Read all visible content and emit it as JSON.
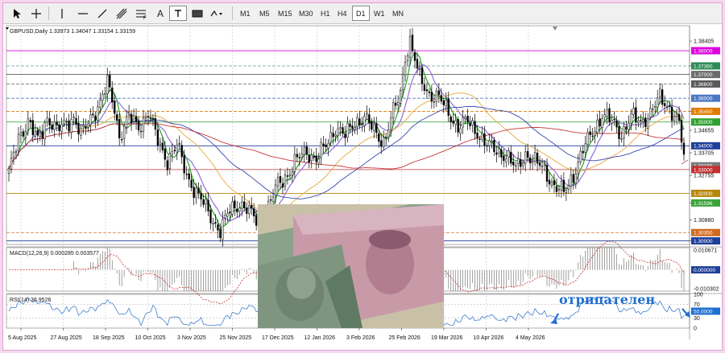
{
  "toolbar": {
    "timeframes": [
      {
        "label": "M1",
        "active": false
      },
      {
        "label": "M5",
        "active": false
      },
      {
        "label": "M15",
        "active": false
      },
      {
        "label": "M30",
        "active": false
      },
      {
        "label": "H1",
        "active": false
      },
      {
        "label": "H4",
        "active": false
      },
      {
        "label": "D1",
        "active": true
      },
      {
        "label": "W1",
        "active": false
      },
      {
        "label": "MN",
        "active": false
      }
    ],
    "text_tool_label": "A",
    "fibo_label": "F"
  },
  "main_pane": {
    "info": "GBPUSD,Daily  1.33973 1.34047 1.33154 1.33159"
  },
  "macd_pane": {
    "info": "MACD(12,26,9) 0.000285 0.003577"
  },
  "rsi_pane": {
    "info": "RSI(14) 36.9526",
    "annotation": "отрицателен",
    "current_value_label": "50.0000"
  },
  "chart_data": [
    {
      "type": "candlestick",
      "symbol": "GBPUSD",
      "timeframe": "Daily",
      "x_labels": [
        "5 Aug 2025",
        "27 Aug 2025",
        "18 Sep 2025",
        "10 Oct 2025",
        "3 Nov 2025",
        "25 Nov 2025",
        "17 Dec 2025",
        "12 Jan 2026",
        "3 Feb 2026",
        "25 Feb 2026",
        "19 Mar 2026",
        "10 Apr 2026",
        "4 May 2026"
      ],
      "y_ticks": [
        "1.38405",
        "1.37360",
        "1.35450",
        "1.34655",
        "1.33705",
        "1.32755",
        "1.31596",
        "1.30880",
        "1.30000"
      ],
      "price_tags": [
        {
          "label": "1.38000",
          "value": 1.38,
          "color": "#dd00dd"
        },
        {
          "label": "1.37360",
          "value": 1.3736,
          "color": "#2e8b57"
        },
        {
          "label": "1.37000",
          "value": 1.37,
          "color": "#6b6b6b"
        },
        {
          "label": "1.36600",
          "value": 1.366,
          "color": "#5a5a5a"
        },
        {
          "label": "1.36000",
          "value": 1.36,
          "color": "#4a78c2"
        },
        {
          "label": "1.35450",
          "value": 1.3545,
          "color": "#e07b00"
        },
        {
          "label": "1.35000",
          "value": 1.35,
          "color": "#2ea02e"
        },
        {
          "label": "1.34000",
          "value": 1.34,
          "color": "#1f3f9a"
        },
        {
          "label": "1.33159",
          "value": 1.33159,
          "color": "#7a7a7a"
        },
        {
          "label": "1.33000",
          "value": 1.33,
          "color": "#c53030"
        },
        {
          "label": "1.32000",
          "value": 1.32,
          "color": "#b8860b"
        },
        {
          "label": "1.31596",
          "value": 1.31596,
          "color": "#3aa33a"
        },
        {
          "label": "1.30350",
          "value": 1.3035,
          "color": "#d2691e"
        },
        {
          "label": "1.30000",
          "value": 1.3,
          "color": "#1f3f9a"
        }
      ],
      "levels": [
        {
          "value": 1.38,
          "color": "#dd00dd",
          "style": "solid"
        },
        {
          "value": 1.3736,
          "color": "#5aa0a0",
          "style": "dashed"
        },
        {
          "value": 1.37,
          "color": "#444444",
          "style": "solid"
        },
        {
          "value": 1.366,
          "color": "#777777",
          "style": "dashed"
        },
        {
          "value": 1.36,
          "color": "#4a78c2",
          "style": "dashed"
        },
        {
          "value": 1.3545,
          "color": "#e07b00",
          "style": "dashed"
        },
        {
          "value": 1.35,
          "color": "#2ea02e",
          "style": "solid"
        },
        {
          "value": 1.34,
          "color": "#1f3f9a",
          "style": "solid"
        },
        {
          "value": 1.33,
          "color": "#c53030",
          "style": "solid"
        },
        {
          "value": 1.32,
          "color": "#b8860b",
          "style": "solid"
        },
        {
          "value": 1.3035,
          "color": "#d2691e",
          "style": "dashed"
        },
        {
          "value": 1.3,
          "color": "#1f3f9a",
          "style": "solid"
        }
      ],
      "ylim": [
        1.2985,
        1.3905
      ],
      "close_path": [
        [
          0,
          1.328
        ],
        [
          4,
          1.344
        ],
        [
          8,
          1.35
        ],
        [
          12,
          1.342
        ],
        [
          16,
          1.352
        ],
        [
          20,
          1.346
        ],
        [
          24,
          1.35
        ],
        [
          27,
          1.352
        ],
        [
          30,
          1.344
        ],
        [
          34,
          1.352
        ],
        [
          38,
          1.358
        ],
        [
          41,
          1.366
        ],
        [
          44,
          1.356
        ],
        [
          46,
          1.344
        ],
        [
          50,
          1.352
        ],
        [
          54,
          1.348
        ],
        [
          58,
          1.354
        ],
        [
          62,
          1.342
        ],
        [
          66,
          1.334
        ],
        [
          70,
          1.34
        ],
        [
          74,
          1.328
        ],
        [
          78,
          1.32
        ],
        [
          82,
          1.314
        ],
        [
          86,
          1.307
        ],
        [
          88,
          1.304
        ],
        [
          92,
          1.313
        ],
        [
          96,
          1.316
        ],
        [
          100,
          1.312
        ],
        [
          104,
          1.308
        ],
        [
          108,
          1.314
        ],
        [
          112,
          1.324
        ],
        [
          116,
          1.328
        ],
        [
          120,
          1.334
        ],
        [
          124,
          1.338
        ],
        [
          128,
          1.334
        ],
        [
          132,
          1.34
        ],
        [
          136,
          1.348
        ],
        [
          140,
          1.344
        ],
        [
          144,
          1.35
        ],
        [
          148,
          1.352
        ],
        [
          152,
          1.346
        ],
        [
          156,
          1.342
        ],
        [
          160,
          1.354
        ],
        [
          163,
          1.362
        ],
        [
          165,
          1.378
        ],
        [
          167,
          1.384
        ],
        [
          169,
          1.376
        ],
        [
          171,
          1.368
        ],
        [
          175,
          1.362
        ],
        [
          179,
          1.36
        ],
        [
          183,
          1.354
        ],
        [
          187,
          1.348
        ],
        [
          191,
          1.35
        ],
        [
          195,
          1.346
        ],
        [
          199,
          1.34
        ],
        [
          203,
          1.338
        ],
        [
          207,
          1.336
        ],
        [
          211,
          1.33
        ],
        [
          215,
          1.337
        ],
        [
          219,
          1.333
        ],
        [
          223,
          1.33
        ],
        [
          227,
          1.323
        ],
        [
          231,
          1.32
        ],
        [
          235,
          1.328
        ],
        [
          239,
          1.338
        ],
        [
          243,
          1.346
        ],
        [
          247,
          1.353
        ],
        [
          251,
          1.35
        ],
        [
          255,
          1.345
        ],
        [
          259,
          1.352
        ],
        [
          263,
          1.35
        ],
        [
          267,
          1.354
        ],
        [
          271,
          1.36
        ],
        [
          275,
          1.356
        ],
        [
          277,
          1.353
        ],
        [
          279,
          1.349
        ],
        [
          281,
          1.335
        ]
      ],
      "series": [
        {
          "name": "",
          "color": "#26a526",
          "period": 5,
          "width": 1.2
        },
        {
          "name": "",
          "color": "#9370db",
          "period": 10,
          "width": 1.2
        },
        {
          "name": "",
          "color": "#e8a73a",
          "period": 30,
          "width": 0.9
        },
        {
          "name": "",
          "color": "#3a46b0",
          "period": 50,
          "width": 0.9
        },
        {
          "name": "",
          "color": "#c63a3a",
          "period": 100,
          "width": 0.9
        }
      ]
    },
    {
      "type": "histogram",
      "name": "MACD(12,26,9)",
      "y_ticks": [
        "0.010671",
        "0.000000",
        "-0.010302"
      ],
      "ylim": [
        -0.0115,
        0.012
      ]
    },
    {
      "type": "line",
      "name": "RSI(14)",
      "y_ticks": [
        "100",
        "70",
        "50",
        "30",
        "0"
      ],
      "ylim": [
        0,
        100
      ]
    }
  ]
}
